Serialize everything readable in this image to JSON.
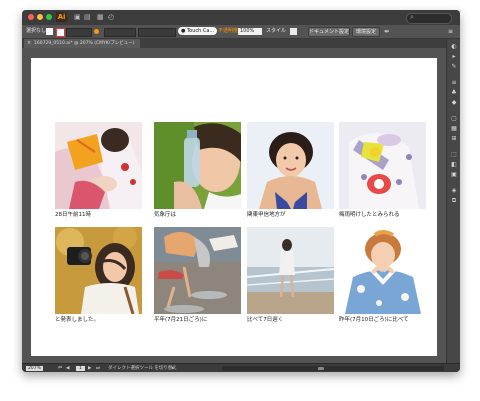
{
  "app": {
    "logo_text": "Ai",
    "brand_color": "#ff9a00"
  },
  "controlbar": {
    "selection_label": "選択なし",
    "brush_label": "Touch Ca...",
    "opacity_label": "不透明度",
    "opacity_value": "100%",
    "style_label": "スタイル",
    "doc_settings_button": "ドキュメント設定",
    "preferences_button": "環境設定"
  },
  "document": {
    "tab_title": "160729_0510.ai* @ 207% (CMYK/プレビュー)"
  },
  "gallery": [
    {
      "caption": "28日午前11時"
    },
    {
      "caption": "気象庁は"
    },
    {
      "caption": "関東甲信地方が"
    },
    {
      "caption": "梅雨明けしたとみられる"
    },
    {
      "caption": "と発表しました。"
    },
    {
      "caption": "平年(7月21日ごろ)に"
    },
    {
      "caption": "比べて7日遅く"
    },
    {
      "caption": "昨年(7月10日ごろ)に比べて"
    }
  ],
  "statusbar": {
    "zoom": "207%",
    "page": "1",
    "tool_hint": "ダイレクト選択ツール を切り替え"
  }
}
